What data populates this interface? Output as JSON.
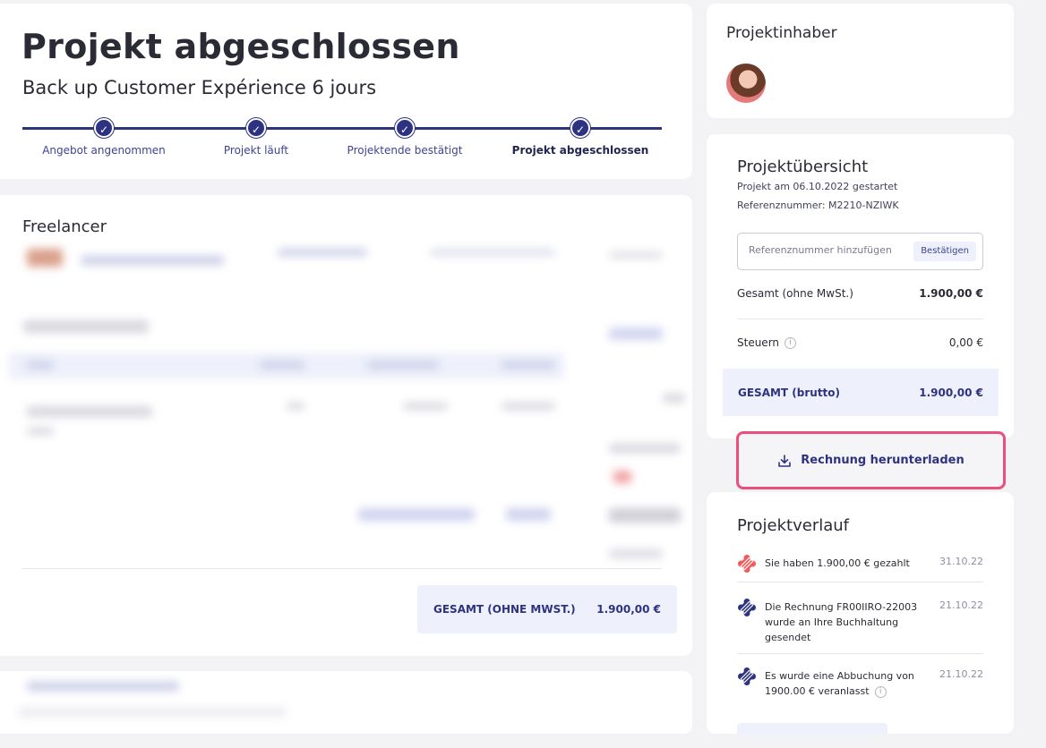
{
  "header": {
    "title": "Projekt abgeschlossen",
    "subtitle": "Back up Customer Expérience 6 jours",
    "steps": [
      {
        "label": "Angebot angenommen",
        "completed": true
      },
      {
        "label": "Projekt läuft",
        "completed": true
      },
      {
        "label": "Projektende bestätigt",
        "completed": true
      },
      {
        "label": "Projekt abgeschlossen",
        "completed": true,
        "active": true
      }
    ]
  },
  "freelancer": {
    "title": "Freelancer",
    "total_label": "GESAMT (OHNE MWST.)",
    "total_value": "1.900,00 €"
  },
  "owner": {
    "title": "Projektinhaber"
  },
  "overview": {
    "title": "Projektübersicht",
    "started": "Projekt am 06.10.2022 gestartet",
    "reference": "Referenznummer: M2210-NZIWK",
    "ref_placeholder": "Referenznummer hinzufügen",
    "confirm_label": "Bestätigen",
    "net_label": "Gesamt (ohne MwSt.)",
    "net_value": "1.900,00 €",
    "tax_label": "Steuern",
    "tax_value": "0,00 €",
    "gross_label": "GESAMT (brutto)",
    "gross_value": "1.900,00 €"
  },
  "download": {
    "label": "Rechnung herunterladen"
  },
  "history": {
    "title": "Projektverlauf",
    "items": [
      {
        "text": "Sie haben 1.900,00 € gezahlt",
        "date": "31.10.22",
        "color": "#f05a5a"
      },
      {
        "text": "Die Rechnung FR00IIRO-22003 wurde an Ihre Buchhaltung gesendet",
        "date": "21.10.22",
        "color": "#2d3380"
      },
      {
        "text": "Es wurde eine Abbuchung von 1900.00 € veranlasst",
        "date": "21.10.22",
        "color": "#2d3380"
      }
    ]
  },
  "colors": {
    "accent": "#2d3380",
    "highlight_border": "#ec4f7b",
    "soft_bg": "#eef0fb"
  }
}
